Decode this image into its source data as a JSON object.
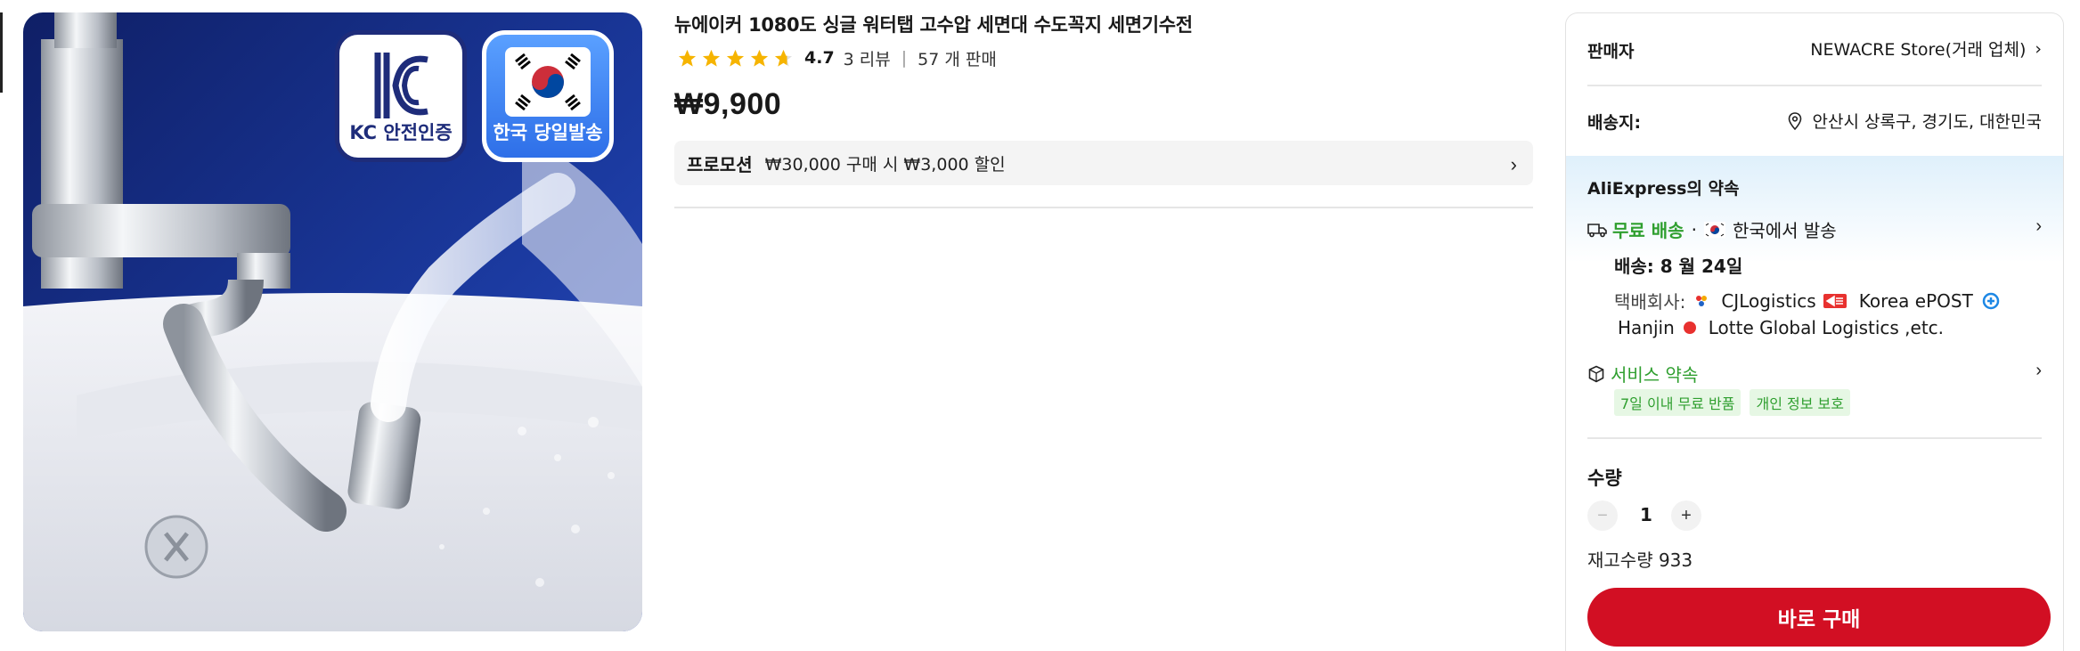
{
  "product": {
    "title": "뉴에이커 1080도 싱글 워터탭 고수압 세면대 수도꼭지 세면기수전",
    "rating": 4.7,
    "rating_text": "4.7",
    "reviews": "3 리뷰",
    "separator": "|",
    "sold": "57 개 판매",
    "price": "₩9,900"
  },
  "image": {
    "badge_kc_caption": "KC 안전인증",
    "badge_kr_caption": "한국 당일발송"
  },
  "promotion": {
    "tag": "프로모션",
    "text": "₩30,000 구매 시 ₩3,000 할인",
    "chevron": "›"
  },
  "seller": {
    "label": "판매자",
    "name": "NEWACRE Store(거래 업체)",
    "chevron": "›"
  },
  "ship_to": {
    "label": "배송지:",
    "location": "안산시 상록구, 경기도, 대한민국"
  },
  "promise": {
    "title": "AliExpress의 약속",
    "free_shipping": "무료 배송",
    "dot": "·",
    "ships_from": "한국에서 발송",
    "delivery": "배송: 8 월 24일",
    "carriers_label": "택배회사:",
    "carrier1": "CJLogistics",
    "carrier2": "Korea ePOST",
    "carrier3": "Hanjin",
    "carrier4": "Lotte Global Logistics ,etc.",
    "service_label": "서비스 약속",
    "tag1": "7일 이내 무료 반품",
    "tag2": "개인 정보 보호",
    "chevron": "›"
  },
  "quantity": {
    "label": "수량",
    "minus": "−",
    "value": "1",
    "plus": "+",
    "stock": "재고수량 933"
  },
  "buy_button": "바로 구매",
  "colors": {
    "accent_red": "#d20f23",
    "star_yellow": "#f6b400",
    "promise_green": "#2f9f2f"
  }
}
